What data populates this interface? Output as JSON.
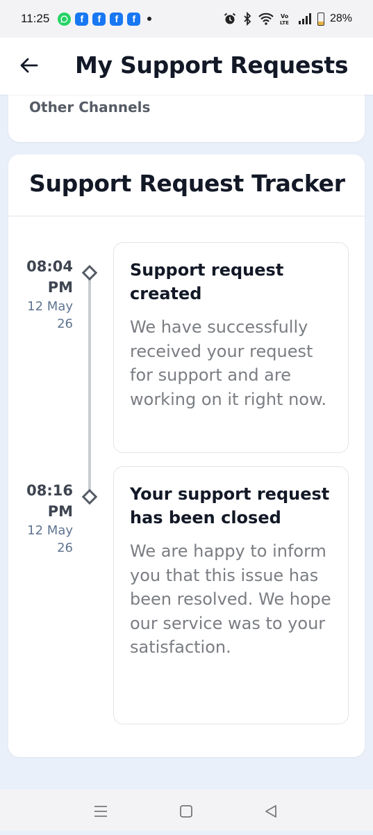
{
  "status_bar": {
    "time": "11:25",
    "battery_percent_label": "28%",
    "battery_level": 0.28,
    "notification_icons": [
      "whatsapp-icon",
      "facebook-icon",
      "facebook-icon",
      "facebook-icon",
      "facebook-icon"
    ],
    "system_icons": [
      "alarm-icon",
      "bluetooth-icon",
      "wifi-icon",
      "volte-icon",
      "signal-icon",
      "battery-icon"
    ]
  },
  "app_bar": {
    "title": "My Support Requests",
    "back_icon": "back-arrow-icon"
  },
  "previous_card": {
    "label": "Other Channels"
  },
  "tracker": {
    "title": "Support Request Tracker",
    "events": [
      {
        "time": "08:04 PM",
        "date": "12 May 26",
        "title": "Support request created",
        "description": "We have successfully received your request for support and are working on it right now."
      },
      {
        "time": "08:16 PM",
        "date": "12 May 26",
        "title": "Your support request has been closed",
        "description": "We are happy to inform you that this issue has been resolved. We hope our service was to your satisfaction."
      }
    ]
  },
  "nav_bar": {
    "buttons": [
      "menu-icon",
      "home-icon",
      "back-icon"
    ]
  },
  "colors": {
    "page_background": "#eaf0fa",
    "card_background": "#ffffff",
    "title_text": "#121826",
    "muted_text": "#7a7d82",
    "date_text": "#5f7490",
    "timeline_line": "#c9ccd1"
  }
}
